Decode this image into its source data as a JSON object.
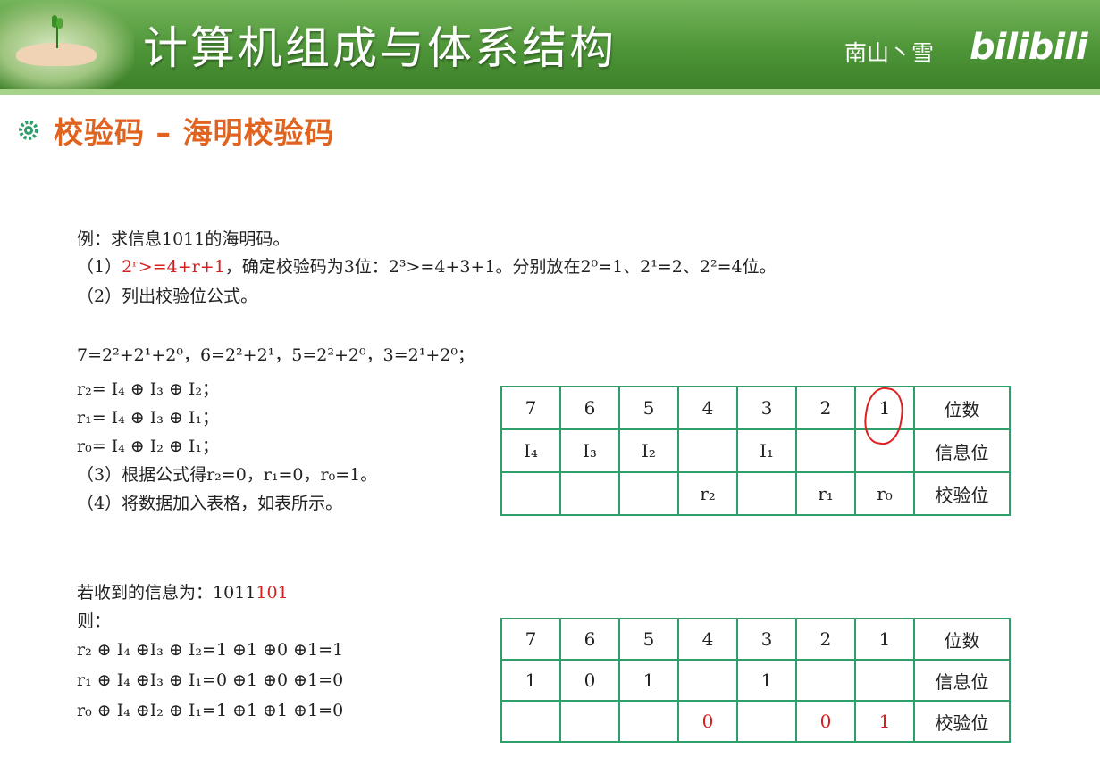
{
  "header": {
    "title": "计算机组成与体系结构",
    "author": "南山丶雪",
    "brand": "bilibili"
  },
  "section": {
    "icon": "gear-icon",
    "title": "校验码 – 海明校验码"
  },
  "example": {
    "intro": "例：求信息1011的海明码。",
    "step1_prefix": "（1）",
    "step1_formula": "2ʳ>=4+r+1",
    "step1_text": "，确定校验码为3位：2³>=4+3+1。分别放在2⁰=1、2¹=2、2²=4位。",
    "step2": "（2）列出校验位公式。",
    "decomp": "7=2²+2¹+2⁰，6=2²+2¹，5=2²+2⁰，3=2¹+2⁰；",
    "r2": "r₂= I₄ ⊕ I₃ ⊕ I₂；",
    "r1": "r₁= I₄ ⊕ I₃ ⊕ I₁；",
    "r0": "r₀= I₄ ⊕ I₂ ⊕ I₁；",
    "step3": "（3）根据公式得r₂=0，r₁=0，r₀=1。",
    "step4": "（4）将数据加入表格，如表所示。"
  },
  "table1": {
    "positions": [
      "7",
      "6",
      "5",
      "4",
      "3",
      "2",
      "1"
    ],
    "info": [
      "I₄",
      "I₃",
      "I₂",
      "",
      "I₁",
      "",
      ""
    ],
    "check": [
      "",
      "",
      "",
      "r₂",
      "",
      "r₁",
      "r₀"
    ],
    "row_labels": [
      "位数",
      "信息位",
      "校验位"
    ]
  },
  "received": {
    "prefix": "若收到的信息为：",
    "bits_black": "1011",
    "bits_red": "101",
    "then": "则：",
    "eq1": "r₂ ⊕ I₄ ⊕I₃ ⊕ I₂=1 ⊕1 ⊕0 ⊕1=1",
    "eq2": "r₁ ⊕ I₄ ⊕I₃ ⊕ I₁=0 ⊕1 ⊕0 ⊕1=0",
    "eq3": "r₀ ⊕ I₄ ⊕I₂ ⊕ I₁=1 ⊕1 ⊕1 ⊕1=0"
  },
  "table2": {
    "positions": [
      "7",
      "6",
      "5",
      "4",
      "3",
      "2",
      "1"
    ],
    "info": [
      "1",
      "0",
      "1",
      "",
      "1",
      "",
      ""
    ],
    "check": [
      "",
      "",
      "",
      "0",
      "",
      "0",
      "1"
    ],
    "row_labels": [
      "位数",
      "信息位",
      "校验位"
    ],
    "check_color": "#d42020"
  }
}
